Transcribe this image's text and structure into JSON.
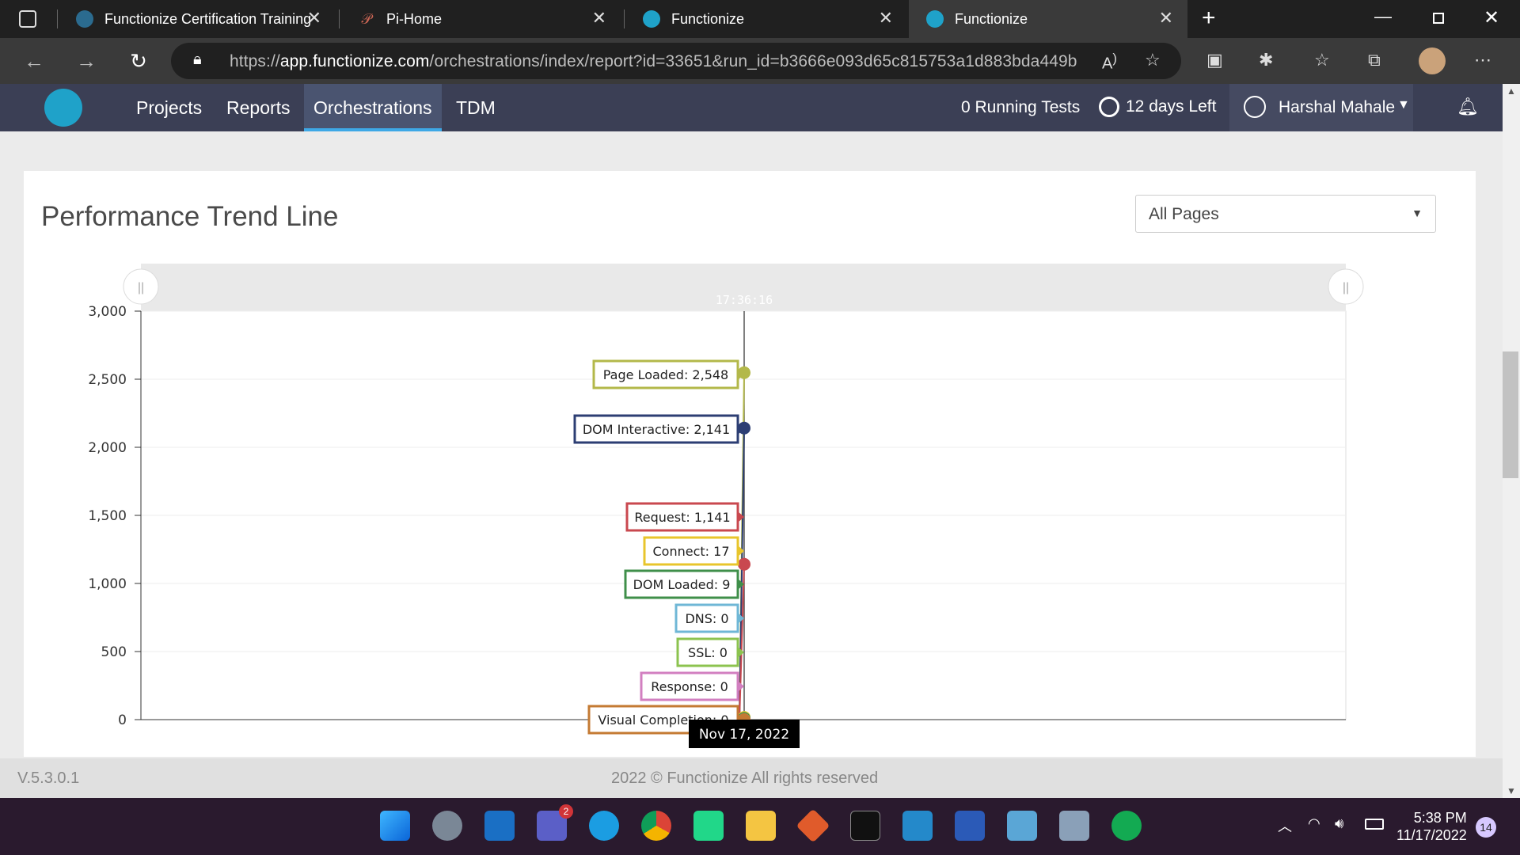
{
  "browser": {
    "tabs": [
      {
        "title": "Functionize Certification Training",
        "active": false
      },
      {
        "title": "Pi-Home",
        "active": false
      },
      {
        "title": "Functionize",
        "active": false
      },
      {
        "title": "Functionize",
        "active": true
      }
    ],
    "url_prefix": "https://",
    "url_host": "app.functionize.com",
    "url_path": "/orchestrations/index/report?id=33651&run_id=b3666e093d65c815753a1d883bda449b"
  },
  "app": {
    "nav": [
      "Projects",
      "Reports",
      "Orchestrations",
      "TDM"
    ],
    "active_nav": "Orchestrations",
    "running_tests": "0 Running Tests",
    "days_left": "12 days Left",
    "user_name": "Harshal Mahale"
  },
  "card": {
    "title": "Performance Trend Line",
    "page_select": "All Pages"
  },
  "chart_data": {
    "type": "line",
    "ylim": [
      0,
      3000
    ],
    "y_ticks": [
      "3,000",
      "2,500",
      "2,000",
      "1,500",
      "1,000",
      "500",
      "0"
    ],
    "crosshair_time": "17:36:16",
    "x_date_label": "Nov 17, 2022",
    "series": [
      {
        "name": "Page Loaded",
        "value": 2548,
        "label": "Page Loaded: 2,548",
        "color": "#b3b84a"
      },
      {
        "name": "DOM Interactive",
        "value": 2141,
        "label": "DOM Interactive: 2,141",
        "color": "#2c3e73"
      },
      {
        "name": "Request",
        "value": 1141,
        "label": "Request: 1,141",
        "color": "#c9484f"
      },
      {
        "name": "Connect",
        "value": 17,
        "label": "Connect: 17",
        "color": "#e8c52c"
      },
      {
        "name": "DOM Loaded",
        "value": 9,
        "label": "DOM Loaded: 9",
        "color": "#3f8f4a"
      },
      {
        "name": "DNS",
        "value": 0,
        "label": "DNS: 0",
        "color": "#6fb7d6"
      },
      {
        "name": "SSL",
        "value": 0,
        "label": "SSL: 0",
        "color": "#8cc34f"
      },
      {
        "name": "Response",
        "value": 0,
        "label": "Response: 0",
        "color": "#d27fc0"
      },
      {
        "name": "Visual Completion",
        "value": 0,
        "label": "Visual Completion: 0",
        "color": "#c47a33"
      }
    ]
  },
  "footer": {
    "version": "V.5.3.0.1",
    "copyright": "2022 © Functionize All rights reserved"
  },
  "taskbar": {
    "time": "5:38 PM",
    "date": "11/17/2022",
    "notifications": "14",
    "teams_badge": "2"
  }
}
